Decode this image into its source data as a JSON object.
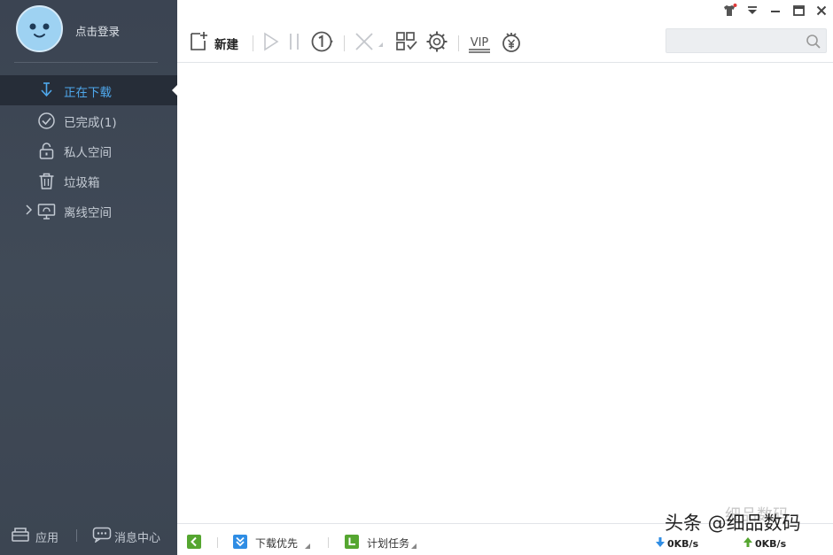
{
  "user": {
    "login_label": "点击登录"
  },
  "sidebar": {
    "items": [
      {
        "label": "正在下载",
        "icon": "download-arrow-icon",
        "active": true
      },
      {
        "label": "已完成(1)",
        "icon": "check-circle-icon",
        "active": false
      },
      {
        "label": "私人空间",
        "icon": "lock-icon",
        "active": false
      },
      {
        "label": "垃圾箱",
        "icon": "trash-icon",
        "active": false
      },
      {
        "label": "离线空间",
        "icon": "cloud-screen-icon",
        "active": false
      }
    ],
    "bottom": {
      "apps_label": "应用",
      "messages_label": "消息中心"
    }
  },
  "toolbar": {
    "new_label": "新建",
    "vip_label": "VIP",
    "search_placeholder": ""
  },
  "statusbar": {
    "priority_label": "下载优先",
    "schedule_label": "计划任务",
    "download_speed": "0KB/s",
    "upload_speed": "0KB/s"
  },
  "watermark": {
    "text": "头条 @细品数码",
    "faint_text": "细品数码"
  },
  "colors": {
    "sidebar_bg": "#3d4653",
    "active_text": "#4fa8ec",
    "accent_green": "#55a630",
    "accent_blue": "#2f8de4"
  }
}
